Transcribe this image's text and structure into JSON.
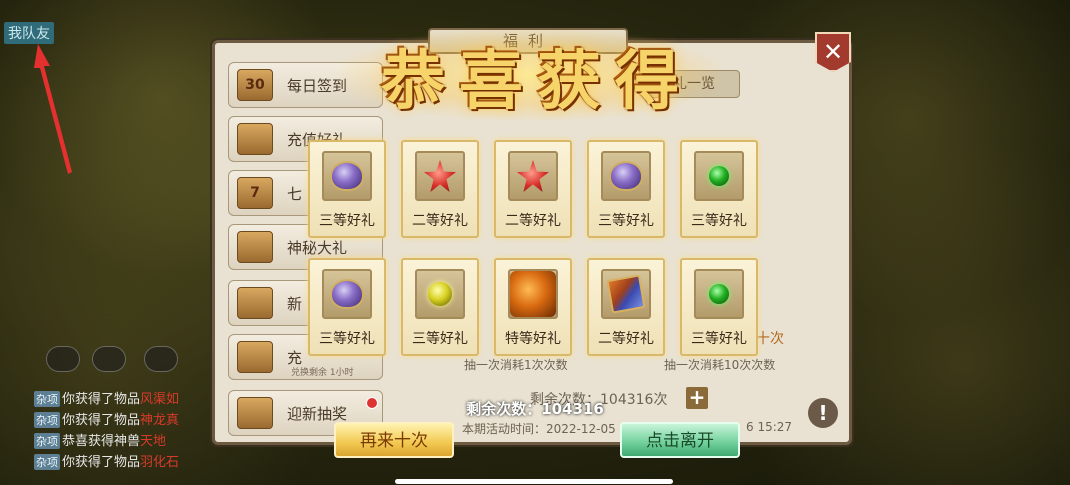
{
  "hud": {
    "team_label": "我队友",
    "chat": [
      {
        "tag": "杂项",
        "text": "你获得了物品",
        "extra": "风渠如"
      },
      {
        "tag": "杂项",
        "text": "你获得了物品",
        "extra": "神龙真"
      },
      {
        "tag": "杂项",
        "text": "恭喜获得神兽",
        "extra": "天地"
      },
      {
        "tag": "杂项",
        "text": "你获得了物品",
        "extra": "羽化石"
      }
    ]
  },
  "panel": {
    "tab_title": "福利",
    "sidebar": [
      {
        "label": "每日签到",
        "icon_text": "30"
      },
      {
        "label": "充值好礼",
        "icon_text": ""
      },
      {
        "label": "七",
        "icon_text": "7"
      },
      {
        "label": "神秘大礼",
        "icon_text": ""
      },
      {
        "label": "新",
        "icon_text": ""
      },
      {
        "label": "充",
        "icon_text": "",
        "sub": "兑换剩余 1小时"
      },
      {
        "label": "迎新抽奖",
        "icon_text": ""
      }
    ],
    "gift_list_label": "好礼一览",
    "background_texts": {
      "single_cost": "抽一次消耗1次次数",
      "ten_cost": "抽一次消耗10次次数",
      "ten_btn": "十次",
      "remaining_bg": "剩余次数：104316次",
      "period": "本期活动时间：2022-12-05",
      "period_end": "6 15:27"
    }
  },
  "reward": {
    "banner_title": "恭喜获得",
    "cards": [
      {
        "label": "三等好礼",
        "icon": "purple-gem-icon"
      },
      {
        "label": "二等好礼",
        "icon": "red-star-icon"
      },
      {
        "label": "二等好礼",
        "icon": "red-star-icon"
      },
      {
        "label": "三等好礼",
        "icon": "purple-gem-icon"
      },
      {
        "label": "三等好礼",
        "icon": "green-orb-icon"
      },
      {
        "label": "三等好礼",
        "icon": "purple-gem-icon"
      },
      {
        "label": "三等好礼",
        "icon": "yellow-orb-icon"
      },
      {
        "label": "特等好礼",
        "icon": "dragon-icon"
      },
      {
        "label": "二等好礼",
        "icon": "book-icon"
      },
      {
        "label": "三等好礼",
        "icon": "green-orb-icon"
      }
    ],
    "remaining_label": "剩余次数：104316",
    "again_button": "再来十次",
    "leave_button": "点击离开"
  }
}
